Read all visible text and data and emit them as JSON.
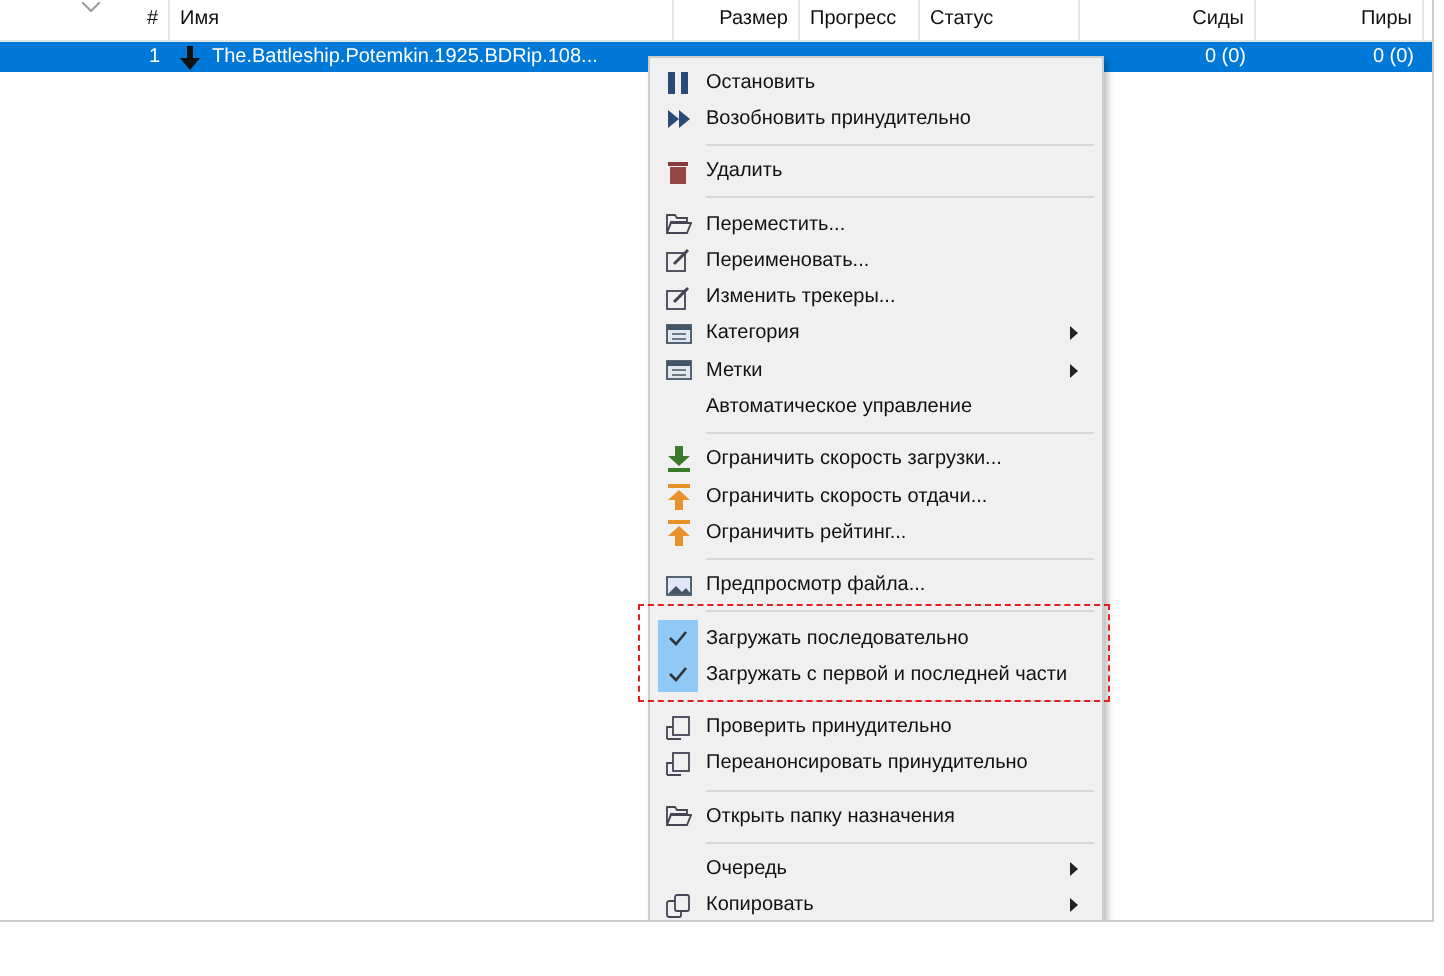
{
  "table": {
    "columns": [
      "#",
      "Имя",
      "Размер",
      "Прогресс",
      "Статус",
      "Сиды",
      "Пиры"
    ],
    "rows": [
      {
        "selected": true,
        "cells": [
          "1",
          "The.Battleship.Potemkin.1925.BDRip.108...",
          "",
          "",
          "",
          "0 (0)",
          "0 (0)"
        ]
      }
    ]
  },
  "context_menu": {
    "groups": [
      {
        "highlighted": false,
        "items": [
          {
            "kind": "pause",
            "label": "Остановить",
            "submenu": false,
            "checked": false
          },
          {
            "kind": "forward",
            "label": "Возобновить принудительно",
            "submenu": false,
            "checked": false
          }
        ]
      },
      {
        "highlighted": false,
        "items": [
          {
            "kind": "trash",
            "label": "Удалить",
            "submenu": false,
            "checked": false
          }
        ]
      },
      {
        "highlighted": false,
        "items": [
          {
            "kind": "folder",
            "label": "Переместить...",
            "submenu": false,
            "checked": false
          },
          {
            "kind": "edit",
            "label": "Переименовать...",
            "submenu": false,
            "checked": false
          },
          {
            "kind": "edit",
            "label": "Изменить трекеры...",
            "submenu": false,
            "checked": false
          },
          {
            "kind": "list",
            "label": "Категория",
            "submenu": true,
            "checked": false
          },
          {
            "kind": "list",
            "label": "Метки",
            "submenu": true,
            "checked": false
          },
          {
            "kind": "plain",
            "label": "Автоматическое управление",
            "submenu": false,
            "checked": false
          }
        ]
      },
      {
        "highlighted": false,
        "items": [
          {
            "kind": "download",
            "label": "Ограничить скорость загрузки...",
            "submenu": false,
            "checked": false
          },
          {
            "kind": "upload",
            "label": "Ограничить скорость отдачи...",
            "submenu": false,
            "checked": false
          },
          {
            "kind": "upload",
            "label": "Ограничить рейтинг...",
            "submenu": false,
            "checked": false
          }
        ]
      },
      {
        "highlighted": false,
        "items": [
          {
            "kind": "image",
            "label": "Предпросмотр файла...",
            "submenu": false,
            "checked": false
          }
        ]
      },
      {
        "highlighted": true,
        "items": [
          {
            "label": "Загружать последовательно",
            "submenu": false,
            "checked": true
          },
          {
            "label": "Загружать с первой и последней части",
            "submenu": false,
            "checked": true
          }
        ]
      },
      {
        "highlighted": false,
        "items": [
          {
            "kind": "recheck",
            "label": "Проверить принудительно",
            "submenu": false,
            "checked": false
          },
          {
            "kind": "recheck",
            "label": "Переанонсировать принудительно",
            "submenu": false,
            "checked": false
          }
        ]
      },
      {
        "highlighted": false,
        "items": [
          {
            "kind": "folder",
            "label": "Открыть папку назначения",
            "submenu": false,
            "checked": false
          }
        ]
      },
      {
        "highlighted": false,
        "items": [
          {
            "kind": "plain",
            "label": "Очередь",
            "submenu": true,
            "checked": false
          },
          {
            "kind": "copy",
            "label": "Копировать",
            "submenu": true,
            "checked": false
          }
        ]
      }
    ]
  }
}
